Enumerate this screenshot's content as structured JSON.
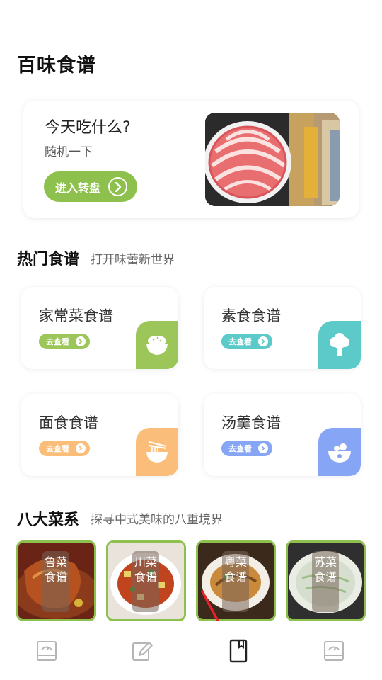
{
  "app_title": "百味食谱",
  "hero": {
    "title": "今天吃什么?",
    "subtitle": "随机一下",
    "button_label": "进入转盘"
  },
  "hot": {
    "title": "热门食谱",
    "subtitle": "打开味蕾新世界",
    "cards": [
      {
        "title": "家常菜食谱",
        "tag": "去查看",
        "color": "#9dc65a",
        "icon": "rice-bowl-icon"
      },
      {
        "title": "素食食谱",
        "tag": "去查看",
        "color": "#5bcac8",
        "icon": "broccoli-icon"
      },
      {
        "title": "面食食谱",
        "tag": "去查看",
        "color": "#fbbd7a",
        "icon": "noodle-bowl-icon"
      },
      {
        "title": "汤羹食谱",
        "tag": "去查看",
        "color": "#86a6f5",
        "icon": "soup-bowl-icon"
      }
    ]
  },
  "cuisines": {
    "title": "八大菜系",
    "subtitle": "探寻中式美味的八重境界",
    "items": [
      {
        "name": "鲁菜食谱"
      },
      {
        "name": "川菜食谱"
      },
      {
        "name": "粤菜食谱"
      },
      {
        "name": "苏菜食谱"
      }
    ]
  },
  "colors": {
    "accent_green": "#8dc04d"
  },
  "tabbar": {
    "icons": [
      "recipe-book-icon",
      "edit-icon",
      "bookmark-icon",
      "recipe-book-icon"
    ]
  }
}
